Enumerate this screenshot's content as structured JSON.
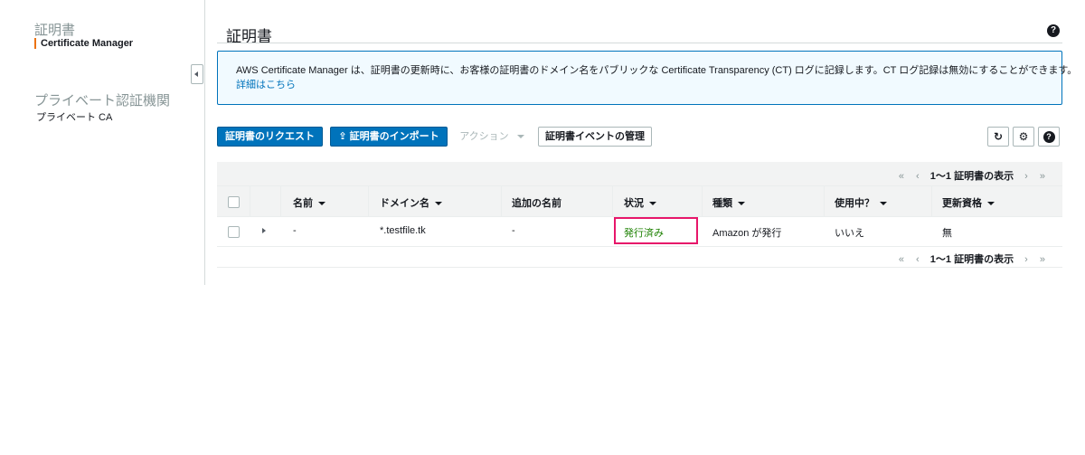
{
  "sidebar": {
    "group1_title": "証明書",
    "group1_items": [
      "Certificate Manager"
    ],
    "group2_title": "プライベート認証機関",
    "group2_items": [
      "プライベート CA"
    ]
  },
  "page": {
    "title": "証明書",
    "help": "?"
  },
  "info": {
    "text": "AWS Certificate Manager は、証明書の更新時に、お客様の証明書のドメイン名をパブリックな Certificate Transparency (CT) ログに記録します。CT ログ記録は無効にすることができます。",
    "link": "詳細はこちら"
  },
  "toolbar": {
    "request": "証明書のリクエスト",
    "import": "証明書のインポート",
    "actions": "アクション",
    "manage_events": "証明書イベントの管理",
    "refresh_icon": "↻",
    "settings_icon": "⚙",
    "help_icon": "?"
  },
  "table": {
    "pager": {
      "first": "«",
      "prev": "‹",
      "count": "1〜1 証明書の表示",
      "next": "›",
      "last": "»"
    },
    "columns": [
      "名前",
      "ドメイン名",
      "追加の名前",
      "状況",
      "種類",
      "使用中？",
      "更新資格"
    ],
    "rows": [
      {
        "name": "-",
        "domain": "*.testfile.tk",
        "additional": "-",
        "status": "発行済み",
        "type": "Amazon が発行",
        "in_use": "いいえ",
        "renewal": "無"
      }
    ]
  },
  "colors": {
    "primary": "#0073bb",
    "accent": "#ec7211",
    "success": "#1d8102",
    "highlight": "#e7166a"
  }
}
